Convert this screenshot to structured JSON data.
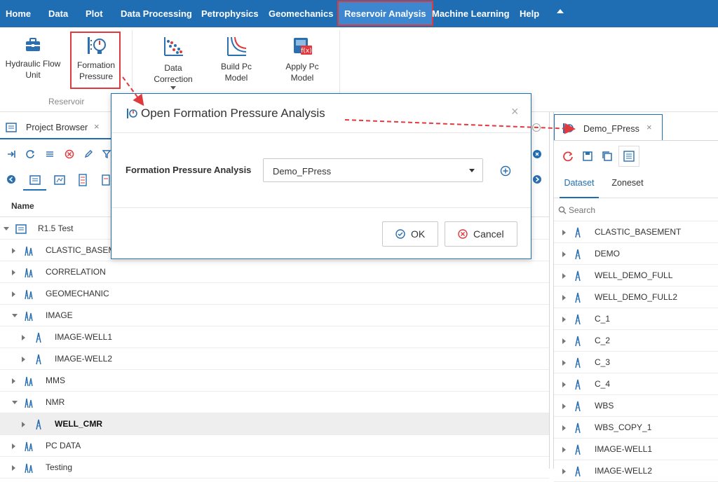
{
  "menubar": {
    "items": [
      "Home",
      "Data",
      "Plot",
      "Data Processing",
      "Petrophysics",
      "Geomechanics",
      "Reservoir Analysis",
      "Machine Learning",
      "Help"
    ],
    "active": "Reservoir Analysis",
    "color": "#1f6db3"
  },
  "ribbon": {
    "buttons": [
      {
        "label": "Hydraulic Flow Unit",
        "line1": "Hydraulic Flow",
        "line2": "Unit",
        "icon": "briefcase-icon"
      },
      {
        "label": "Formation Pressure",
        "line1": "Formation",
        "line2": "Pressure",
        "icon": "pressure-gauge-icon"
      },
      {
        "label": "Data Correction",
        "line1": "Data",
        "line2": "Correction",
        "icon": "scatter-grid-icon"
      },
      {
        "label": "Build Pc Model",
        "line1": "Build Pc",
        "line2": "Model",
        "icon": "pc-curve-icon"
      },
      {
        "label": "Apply Pc Model",
        "line1": "Apply Pc",
        "line2": "Model",
        "icon": "apply-fx-icon"
      }
    ],
    "group_label": "Reservoir"
  },
  "left_panel": {
    "tab_label": "Project Browser",
    "column_header": "Name",
    "tree": [
      {
        "label": "R1.5 Test",
        "level": 0,
        "state": "expanded",
        "icon": "project-icon"
      },
      {
        "label": "CLASTIC_BASEMENT",
        "level": 1,
        "state": "collapsed",
        "icon": "wells-icon"
      },
      {
        "label": "CORRELATION",
        "level": 1,
        "state": "collapsed",
        "icon": "wells-icon"
      },
      {
        "label": "GEOMECHANIC",
        "level": 1,
        "state": "collapsed",
        "icon": "wells-icon"
      },
      {
        "label": "IMAGE",
        "level": 1,
        "state": "expanded",
        "icon": "wells-icon"
      },
      {
        "label": "IMAGE-WELL1",
        "level": 2,
        "state": "collapsed",
        "icon": "well-icon"
      },
      {
        "label": "IMAGE-WELL2",
        "level": 2,
        "state": "collapsed",
        "icon": "well-icon"
      },
      {
        "label": "MMS",
        "level": 1,
        "state": "collapsed",
        "icon": "wells-icon"
      },
      {
        "label": "NMR",
        "level": 1,
        "state": "expanded",
        "icon": "wells-icon"
      },
      {
        "label": "WELL_CMR",
        "level": 2,
        "state": "collapsed",
        "icon": "well-icon",
        "selected": true
      },
      {
        "label": "PC DATA",
        "level": 1,
        "state": "collapsed",
        "icon": "wells-icon"
      },
      {
        "label": "Testing",
        "level": 1,
        "state": "collapsed",
        "icon": "wells-icon"
      }
    ]
  },
  "dialog": {
    "title": "Open Formation Pressure Analysis",
    "field_label": "Formation Pressure Analysis",
    "selected_value": "Demo_FPress",
    "ok_label": "OK",
    "cancel_label": "Cancel"
  },
  "right_panel": {
    "tab_label": "Demo_FPress",
    "tabs": [
      "Dataset",
      "Zoneset"
    ],
    "active_tab": "Dataset",
    "search_placeholder": "Search",
    "items": [
      "CLASTIC_BASEMENT",
      "DEMO",
      "WELL_DEMO_FULL",
      "WELL_DEMO_FULL2",
      "C_1",
      "C_2",
      "C_3",
      "C_4",
      "WBS",
      "WBS_COPY_1",
      "IMAGE-WELL1",
      "IMAGE-WELL2"
    ]
  },
  "colors": {
    "accent": "#1f6db3",
    "highlight_border": "#e0393e",
    "arrow": "#e0393e"
  }
}
